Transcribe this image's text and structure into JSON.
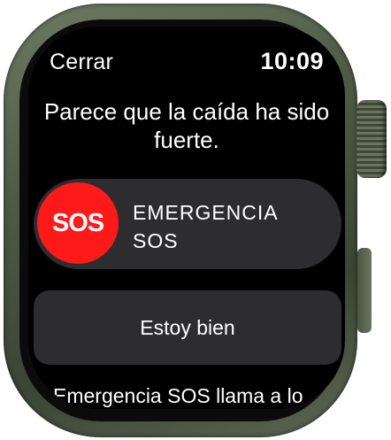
{
  "top_bar": {
    "close_label": "Cerrar",
    "time": "10:09"
  },
  "alert": {
    "message": "Parece que la caída ha sido fuerte."
  },
  "sos_slider": {
    "knob_label": "SOS",
    "label": "EMERGENCIA SOS"
  },
  "ok_button": {
    "label": "Estoy bien"
  },
  "footer": {
    "text": "Emergencia SOS llama a lo"
  },
  "colors": {
    "sos_red": "#ff1a1a",
    "button_bg": "#2d2d2f",
    "screen_bg": "#000000"
  }
}
